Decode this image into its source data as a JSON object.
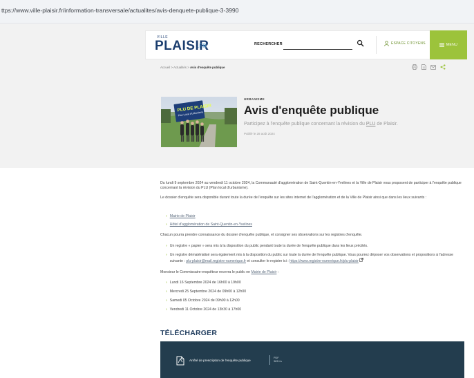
{
  "browser": {
    "url": "ttps://www.ville-plaisir.fr/information-transversale/actualites/avis-denquete-publique-3-3990"
  },
  "header": {
    "logo_small": "VILLE",
    "logo_main": "PLAISIR",
    "logo_suffix": ".FR",
    "search_label": "RECHERCHER",
    "search_value": "",
    "espace_label": "ESPACE CITOYENS",
    "menu_label": "MENU",
    "accent_color": "#9cc33b",
    "brand_color": "#1b3d6e"
  },
  "breadcrumb": {
    "home": "Accueil",
    "section": "Actualités",
    "current": "Avis d'enquête publique",
    "separator": ">"
  },
  "tools": [
    "print-icon",
    "document-icon",
    "mail-icon",
    "share-icon"
  ],
  "article": {
    "category": "URBANISME",
    "title": "Avis d'enquête publique",
    "subtitle_before": "Participez à l'enquête publique concernant la révision du ",
    "subtitle_link": "PLU",
    "subtitle_after": " de Plaisir.",
    "published": "Publié le 28 août 2024",
    "photo_sign_line1": "PLU DE PLAISIR",
    "photo_sign_line2": "Plan Local d'Urbanisme"
  },
  "body": {
    "p1": "Du lundi 9 septembre 2024 au vendredi 11 octobre 2024, la Communauté d'agglomération de Saint-Quentin-en-Yvelines et la Ville de Plaisir vous proposent de participer à l'enquête publique concernant la révision du PLU (Plan local d'urbanisme).",
    "p2": "Le dossier d'enquête sera disponible durant toute la durée de l'enquête sur les sites internet de l'agglomération et de la Ville de Plaisir ainsi que dans les lieux suivants :",
    "places": [
      "Mairie de Plaisir",
      "Hôtel d'agglomération de Saint-Quentin-en-Yvelines"
    ],
    "p3": "Chacun pourra prendre connaissance du dossier d'enquête publique, et consigner ses observations sur les registres d'enquête.",
    "reg1": "Un registre « papier » sera mis à la disposition du public pendant toute la durée de l'enquête publique dans les lieux précités.",
    "reg2_before": "Un registre dématérialisé sera également mis à la disposition du public sur toute la durée de l'enquête publique. Vous pourrez déposer vos observations et propositions à l'adresse suivante : ",
    "reg2_email": "plu-plaisir@mail.registre-numerique.fr",
    "reg2_mid": " et consulter le registre ici : ",
    "reg2_url": "https://www.registre-numerique.fr/plu-plaisir",
    "p4_before": "Monsieur le Commissaire-enquêteur recevra le public en ",
    "p4_link": "Mairie de Plaisir",
    "p4_after": " :",
    "dates": [
      "Lundi 16 Septembre 2024 de 16h00 à 19h00",
      "Mercredi 25 Septembre 2024 de 09h00 à 12h00",
      "Samedi 05 Octobre 2024 de 09h00 à 12h00",
      "Vendredi 11 Octobre 2024 de 13h30 à 17h00"
    ]
  },
  "download": {
    "section_title": "TÉLÉCHARGER",
    "file_label": "Arrêté de prescription de l'enquête publique",
    "file_type": "PDF",
    "file_size": "383 Ko",
    "box_color": "#233d4e"
  }
}
